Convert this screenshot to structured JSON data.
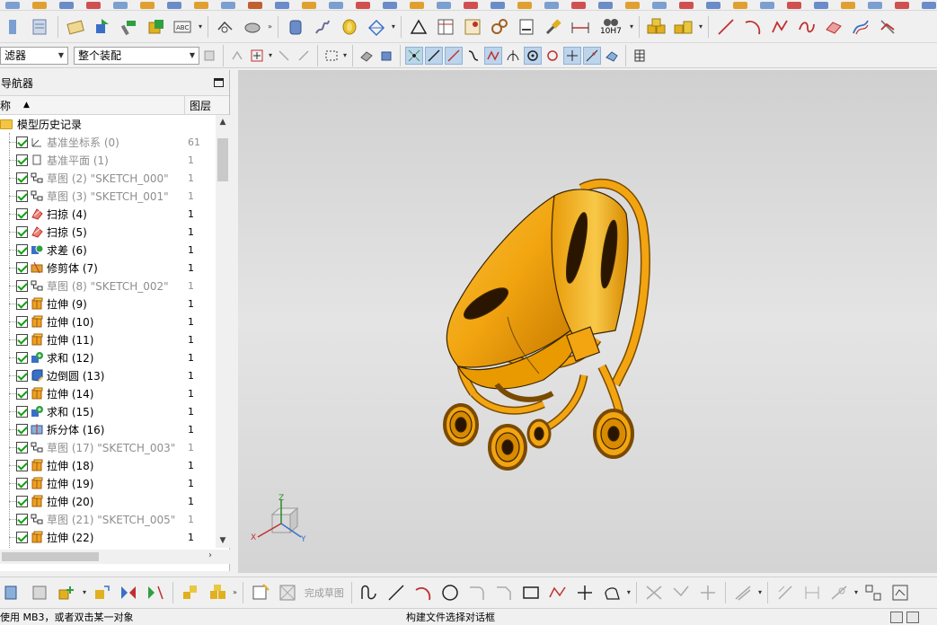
{
  "toolbar_top": {
    "tolerance_label": "10H7"
  },
  "filters": {
    "selection_filter": "滤器",
    "scope": "整个装配"
  },
  "navigator": {
    "title": "导航器",
    "col_name": "称",
    "col_layer": "图层",
    "root_label": "模型历史记录",
    "rows": [
      {
        "label": "基准坐标系 (0)",
        "layer": "61",
        "icon": "datum-csys-icon",
        "dim": true
      },
      {
        "label": "基准平面 (1)",
        "layer": "1",
        "icon": "datum-plane-icon",
        "dim": true
      },
      {
        "label": "草图 (2) \"SKETCH_000\"",
        "layer": "1",
        "icon": "sketch-icon",
        "dim": true
      },
      {
        "label": "草图 (3) \"SKETCH_001\"",
        "layer": "1",
        "icon": "sketch-icon",
        "dim": true
      },
      {
        "label": "扫掠 (4)",
        "layer": "1",
        "icon": "sweep-icon",
        "dim": false
      },
      {
        "label": "扫掠 (5)",
        "layer": "1",
        "icon": "sweep-icon",
        "dim": false
      },
      {
        "label": "求差 (6)",
        "layer": "1",
        "icon": "subtract-icon",
        "dim": false
      },
      {
        "label": "修剪体 (7)",
        "layer": "1",
        "icon": "trim-body-icon",
        "dim": false
      },
      {
        "label": "草图 (8) \"SKETCH_002\"",
        "layer": "1",
        "icon": "sketch-icon",
        "dim": true
      },
      {
        "label": "拉伸 (9)",
        "layer": "1",
        "icon": "extrude-icon",
        "dim": false
      },
      {
        "label": "拉伸 (10)",
        "layer": "1",
        "icon": "extrude-icon",
        "dim": false
      },
      {
        "label": "拉伸 (11)",
        "layer": "1",
        "icon": "extrude-icon",
        "dim": false
      },
      {
        "label": "求和 (12)",
        "layer": "1",
        "icon": "unite-icon",
        "dim": false
      },
      {
        "label": "边倒圆 (13)",
        "layer": "1",
        "icon": "edge-blend-icon",
        "dim": false
      },
      {
        "label": "拉伸 (14)",
        "layer": "1",
        "icon": "extrude-icon",
        "dim": false
      },
      {
        "label": "求和 (15)",
        "layer": "1",
        "icon": "unite-icon",
        "dim": false
      },
      {
        "label": "拆分体 (16)",
        "layer": "1",
        "icon": "split-body-icon",
        "dim": false
      },
      {
        "label": "草图 (17) \"SKETCH_003\"",
        "layer": "1",
        "icon": "sketch-icon",
        "dim": true
      },
      {
        "label": "拉伸 (18)",
        "layer": "1",
        "icon": "extrude-icon",
        "dim": false
      },
      {
        "label": "拉伸 (19)",
        "layer": "1",
        "icon": "extrude-icon",
        "dim": false
      },
      {
        "label": "拉伸 (20)",
        "layer": "1",
        "icon": "extrude-icon",
        "dim": false
      },
      {
        "label": "草图 (21) \"SKETCH_005\"",
        "layer": "1",
        "icon": "sketch-icon",
        "dim": true
      },
      {
        "label": "拉伸 (22)",
        "layer": "1",
        "icon": "extrude-icon",
        "dim": false
      }
    ]
  },
  "viewport": {
    "model_color": "#f2a510",
    "triad": {
      "x": "X",
      "y": "Y",
      "z": "Z"
    }
  },
  "bottom_toolbar": {
    "finish_sketch": "完成草图"
  },
  "status": {
    "left": "使用 MB3，或者双击某一对象",
    "middle": "构建文件选择对话框"
  }
}
